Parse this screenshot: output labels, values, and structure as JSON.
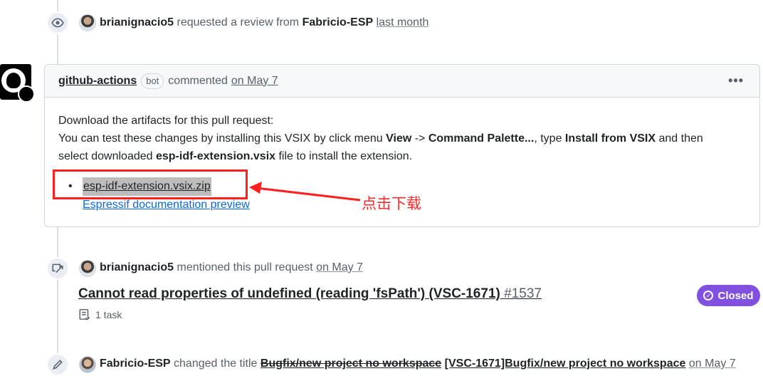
{
  "colors": {
    "accent_purple": "#8250df",
    "link_blue": "#0969da",
    "annotation_red": "#ff1f1f"
  },
  "events": {
    "review_request": {
      "icon": "eye-icon",
      "user": "brianignacio5",
      "text": "requested a review from",
      "target": "Fabricio-ESP",
      "time": "last month"
    },
    "mention": {
      "icon": "cross-reference-icon",
      "user": "brianignacio5",
      "text": "mentioned this pull request",
      "time": "on May 7"
    },
    "title_change": {
      "icon": "pencil-icon",
      "user": "Fabricio-ESP",
      "text": "changed the title",
      "old_title": "Bugfix/new project no workspace",
      "new_title": "[VSC-1671]Bugfix/new project no workspace",
      "time": "on May 7"
    }
  },
  "comment": {
    "author": "github-actions",
    "bot_label": "bot",
    "action": "commented",
    "time": "on May 7",
    "menu_icon": "kebab-icon",
    "line1": "Download the artifacts for this pull request:",
    "line2_prefix": "You can test these changes by installing this VSIX by click menu ",
    "line2_view": "View",
    "line2_arrow": " -> ",
    "line2_palette": "Command Palette...",
    "line2_type": ", type ",
    "line2_install": "Install from VSIX",
    "line2_suffix": " and then",
    "line3_prefix": "select downloaded ",
    "line3_file": "esp-idf-extension.vsix",
    "line3_suffix": " file to install the extension.",
    "artifact_link": "esp-idf-extension.vsix.zip",
    "doc_link": "Espressif documentation preview"
  },
  "annotation": {
    "text": "点击下载"
  },
  "issue": {
    "title": "Cannot read properties of undefined (reading 'fsPath') (VSC-1671)",
    "number": "#1537",
    "tasks": "1 task",
    "status": "Closed"
  }
}
